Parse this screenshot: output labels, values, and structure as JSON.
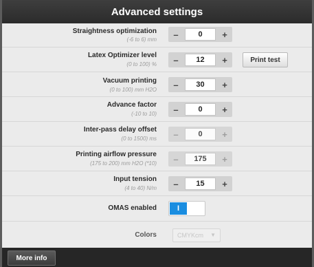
{
  "window": {
    "title": "Advanced settings"
  },
  "settings": [
    {
      "label": "Straightness optimization",
      "range": "(-6 to 6) mm",
      "value": "0",
      "enabled": true
    },
    {
      "label": "Latex Optimizer level",
      "range": "(0 to 100) %",
      "value": "12",
      "enabled": true,
      "action": "Print test"
    },
    {
      "label": "Vacuum printing",
      "range": "(0 to 100) mm H2O",
      "value": "30",
      "enabled": true
    },
    {
      "label": "Advance factor",
      "range": "(-10 to 10)",
      "value": "0",
      "enabled": true
    },
    {
      "label": "Inter-pass delay offset",
      "range": "(0 to 1500) ms",
      "value": "0",
      "enabled": false
    },
    {
      "label": "Printing airflow pressure",
      "range": "(175 to 200) mm H2O (*10)",
      "value": "175",
      "enabled": false
    },
    {
      "label": "Input tension",
      "range": "(4 to 40) N/m",
      "value": "15",
      "enabled": true
    }
  ],
  "stepper": {
    "minus": "–",
    "plus": "+"
  },
  "omas": {
    "label": "OMAS enabled",
    "state": "I"
  },
  "colors": {
    "label": "Colors",
    "value": "CMYKcm",
    "enabled": false
  },
  "footer": {
    "more_info": "More info"
  }
}
